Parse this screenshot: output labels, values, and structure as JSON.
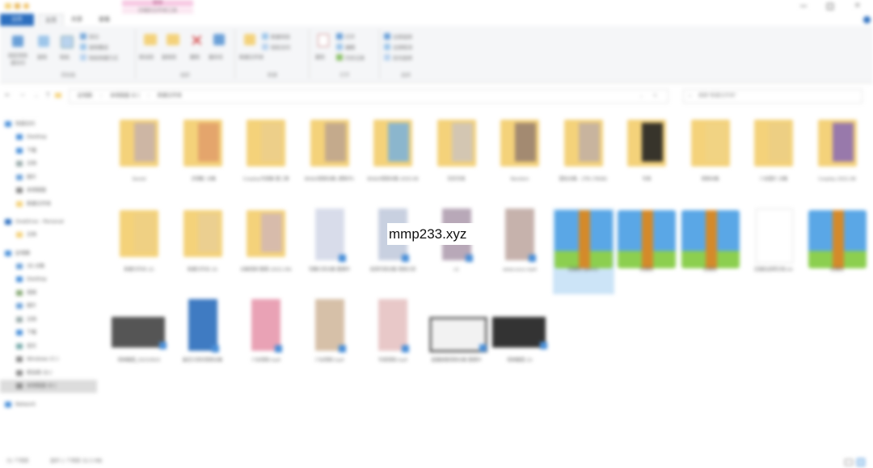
{
  "window": {
    "title_bar_tab": "管理",
    "context_tab": "压缩的文件夹工具",
    "controls": [
      "minimize-icon",
      "maximize-icon",
      "close-icon"
    ],
    "help_icon": "help-icon"
  },
  "ribbon": {
    "tabs": [
      "文件",
      "主页",
      "共享",
      "查看"
    ],
    "groups": [
      {
        "name": "剪贴板",
        "items": [
          "固定到快速访问",
          "复制",
          "粘贴",
          "剪切",
          "复制路径",
          "粘贴快捷方式"
        ]
      },
      {
        "name": "组织",
        "items": [
          "移动到",
          "复制到",
          "删除",
          "重命名"
        ]
      },
      {
        "name": "新建",
        "items": [
          "新建文件夹",
          "新建项目",
          "轻松访问"
        ]
      },
      {
        "name": "打开",
        "items": [
          "属性",
          "打开",
          "编辑",
          "历史记录"
        ]
      },
      {
        "name": "选择",
        "items": [
          "全部选择",
          "全部取消",
          "反向选择"
        ]
      }
    ]
  },
  "address": {
    "path": [
      "此电脑",
      "本地磁盘 (E:)",
      "新建文件夹"
    ],
    "search_placeholder": "搜索\"新建文件夹\""
  },
  "nav_pane": {
    "items": [
      {
        "label": "快速访问",
        "icon": "star-icon",
        "level": 0
      },
      {
        "label": "Desktop",
        "icon": "desktop-icon",
        "level": 1
      },
      {
        "label": "下载",
        "icon": "download-icon",
        "level": 1
      },
      {
        "label": "文档",
        "icon": "document-icon",
        "level": 1
      },
      {
        "label": "图片",
        "icon": "picture-icon",
        "level": 1
      },
      {
        "label": "本地磁盘",
        "icon": "drive-icon",
        "level": 1
      },
      {
        "label": "新建文件夹",
        "icon": "folder-icon",
        "level": 1
      },
      {
        "label": "OneDrive - Personal",
        "icon": "cloud-icon",
        "level": 0
      },
      {
        "label": "文档",
        "icon": "folder-icon",
        "level": 1
      },
      {
        "label": "此电脑",
        "icon": "pc-icon",
        "level": 0
      },
      {
        "label": "3D 对象",
        "icon": "cube-icon",
        "level": 1
      },
      {
        "label": "Desktop",
        "icon": "desktop-icon",
        "level": 1
      },
      {
        "label": "视频",
        "icon": "video-icon",
        "level": 1
      },
      {
        "label": "图片",
        "icon": "picture-icon",
        "level": 1
      },
      {
        "label": "文档",
        "icon": "document-icon",
        "level": 1
      },
      {
        "label": "下载",
        "icon": "download-icon",
        "level": 1
      },
      {
        "label": "音乐",
        "icon": "music-icon",
        "level": 1
      },
      {
        "label": "Windows (C:)",
        "icon": "drive-icon",
        "level": 1
      },
      {
        "label": "新加卷 (D:)",
        "icon": "drive-icon",
        "level": 1
      },
      {
        "label": "本地磁盘 (E:)",
        "icon": "drive-icon",
        "level": 1
      },
      {
        "label": "Network",
        "icon": "network-icon",
        "level": 0
      }
    ]
  },
  "files": [
    {
      "label": "Saved",
      "type": "folder"
    },
    {
      "label": "【宅舞】合集",
      "type": "folder"
    },
    {
      "label": "Cosplay写真集 第二弹",
      "type": "folder"
    },
    {
      "label": "Bilibili视频合集 (更新中)",
      "type": "folder"
    },
    {
      "label": "Bilibili视频合集 2020.08",
      "type": "folder"
    },
    {
      "label": "花花写真",
      "type": "folder"
    },
    {
      "label": "Random",
      "type": "folder"
    },
    {
      "label": "图包合集 - 2TB (78GB)",
      "type": "folder"
    },
    {
      "label": "写真",
      "type": "folder"
    },
    {
      "label": "视频合集",
      "type": "folder"
    },
    {
      "label": "少女图片 合集",
      "type": "folder"
    },
    {
      "label": "Cosplay 2021.08",
      "type": "folder"
    },
    {
      "label": "新建文件夹 (2)",
      "type": "folder"
    },
    {
      "label": "新建文件夹 (3)",
      "type": "folder"
    },
    {
      "label": "合集视频 整理 (2021.09)",
      "type": "folder"
    },
    {
      "label": "宅舞分享合集 整理中",
      "type": "video"
    },
    {
      "label": "高清写真合集 视频分享",
      "type": "video"
    },
    {
      "label": "v1",
      "type": "video"
    },
    {
      "label": "www.xxxx.mp4",
      "type": "video"
    },
    {
      "label": "压缩包 (part1)",
      "type": "archive"
    },
    {
      "label": "压缩包",
      "type": "archive"
    },
    {
      "label": "压缩包",
      "type": "archive"
    },
    {
      "label": "压缩包说明文档.txt",
      "type": "text"
    },
    {
      "label": "压缩包",
      "type": "archive"
    },
    {
      "label": "视频截图_20210915",
      "type": "video"
    },
    {
      "label": "最近分享的视频合集",
      "type": "video"
    },
    {
      "label": "少女视频.mp4",
      "type": "video"
    },
    {
      "label": "少女视频.mp4",
      "type": "video"
    },
    {
      "label": "写真视频.mp4",
      "type": "video"
    },
    {
      "label": "直播录像视频合集 整理中",
      "type": "video"
    },
    {
      "label": "视频截图 (2)",
      "type": "video"
    }
  ],
  "status": {
    "item_count": "31 个项目",
    "selection": "选中 1 个项目 32.5 MB",
    "view_icons": [
      "details-view-icon",
      "large-icons-view-icon"
    ]
  },
  "watermark": {
    "text": "mmp233.xyz"
  },
  "colors": {
    "folder_yellow": "#f4d27a",
    "folder_tab": "#e8bc5a",
    "archive_blue": "#5aa7e6",
    "archive_green": "#8ccf4f",
    "archive_strap": "#d48a2a",
    "accent_blue": "#2d6fbf",
    "selection": "#cce4f7"
  }
}
